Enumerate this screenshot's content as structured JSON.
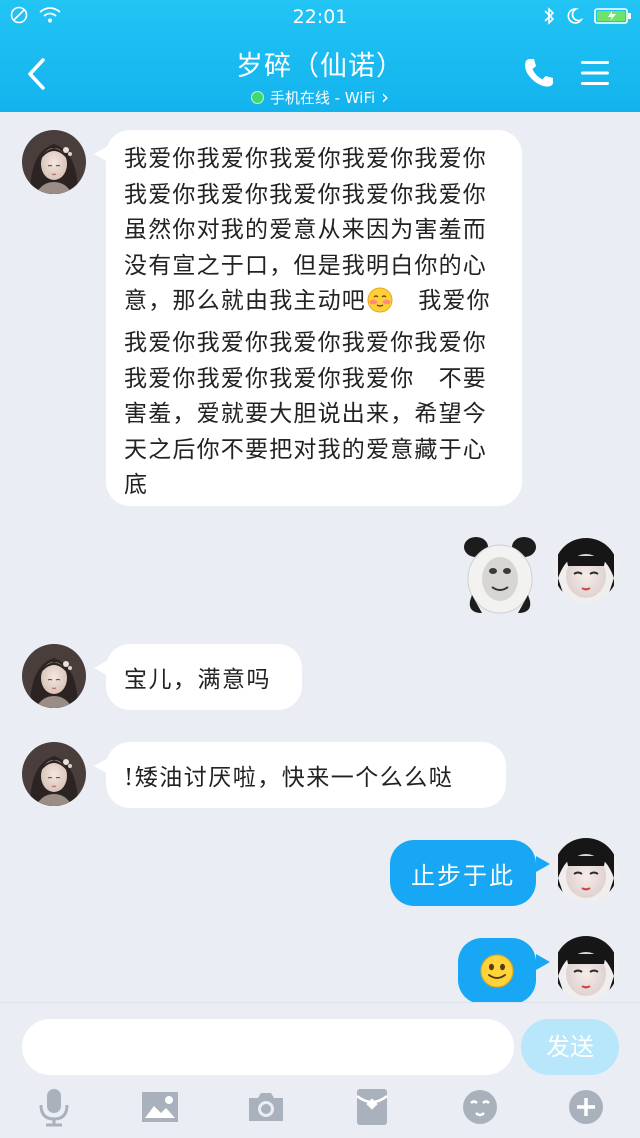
{
  "status_bar": {
    "time": "22:01"
  },
  "header": {
    "title": "岁碎（仙诺）",
    "subtitle": "手机在线 - WiFi",
    "subtitle_arrow": "›"
  },
  "messages": [
    {
      "side": "in",
      "text_before": "我爱你我爱你我爱你我爱你我爱你我爱你我爱你我爱你我爱你我爱你　虽然你对我的爱意从来因为害羞而没有宣之于口，但是我明白你的心意，那么就由我主动吧",
      "emoji": "blushing-face",
      "text_after": "　我爱你我爱你我爱你我爱你我爱你我爱你我爱你我爱你我爱你我爱你　不要害羞，爱就要大胆说出来，希望今天之后你不要把对我的爱意藏于心底"
    },
    {
      "side": "out",
      "sticker": "panda-meme-sticker"
    },
    {
      "side": "in",
      "text": "宝儿，满意吗"
    },
    {
      "side": "in",
      "text": "!矮油讨厌啦，快来一个么么哒"
    },
    {
      "side": "out",
      "text": "止步于此"
    },
    {
      "side": "out",
      "emoji": "smiling-face"
    }
  ],
  "input": {
    "value": "",
    "send_label": "发送"
  },
  "toolbar": [
    "mic-icon",
    "image-icon",
    "camera-icon",
    "red-packet-icon",
    "emoji-icon",
    "plus-icon"
  ],
  "colors": {
    "header": "#13b3ee",
    "out_bubble": "#17a7f5",
    "in_bubble": "#ffffff",
    "background": "#eaedf4",
    "send_disabled": "#b8e6fb"
  }
}
